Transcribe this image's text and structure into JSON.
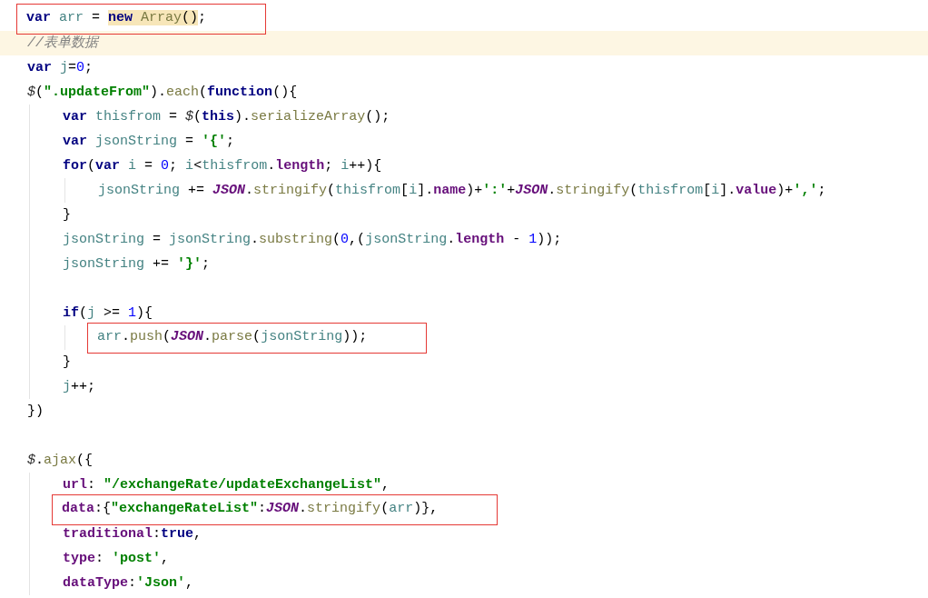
{
  "editor": {
    "lines": [
      {
        "kind": "code",
        "boxed": true,
        "current": false,
        "tokens": [
          {
            "kind": "kw",
            "text": "var "
          },
          {
            "kind": "var",
            "text": "arr"
          },
          {
            "kind": "punct",
            "text": " = "
          },
          {
            "kind": "kw",
            "text": "new ",
            "highlighted": true
          },
          {
            "kind": "fn",
            "text": "Array",
            "highlighted": true
          },
          {
            "kind": "punct",
            "text": "()",
            "highlighted": true
          },
          {
            "kind": "punct",
            "text": ";"
          }
        ]
      },
      {
        "kind": "code",
        "boxed": false,
        "current": true,
        "tokens": [
          {
            "kind": "comment",
            "text": "//表单数据"
          }
        ]
      },
      {
        "kind": "code",
        "boxed": false,
        "current": false,
        "tokens": [
          {
            "kind": "kw",
            "text": "var "
          },
          {
            "kind": "var",
            "text": "j"
          },
          {
            "kind": "punct",
            "text": "="
          },
          {
            "kind": "num",
            "text": "0"
          },
          {
            "kind": "punct",
            "text": ";"
          }
        ]
      },
      {
        "kind": "code",
        "boxed": false,
        "current": false,
        "tokens": [
          {
            "kind": "global",
            "text": "$"
          },
          {
            "kind": "punct",
            "text": "("
          },
          {
            "kind": "str",
            "text": "\".updateFrom\""
          },
          {
            "kind": "punct",
            "text": ")."
          },
          {
            "kind": "fn",
            "text": "each"
          },
          {
            "kind": "punct",
            "text": "("
          },
          {
            "kind": "kw",
            "text": "function"
          },
          {
            "kind": "punct",
            "text": "(){"
          }
        ],
        "children": [
          {
            "kind": "code",
            "boxed": false,
            "current": false,
            "tokens": [
              {
                "kind": "kw",
                "text": "var "
              },
              {
                "kind": "var",
                "text": "thisfrom"
              },
              {
                "kind": "punct",
                "text": " = "
              },
              {
                "kind": "global",
                "text": "$"
              },
              {
                "kind": "punct",
                "text": "("
              },
              {
                "kind": "kw",
                "text": "this"
              },
              {
                "kind": "punct",
                "text": ")."
              },
              {
                "kind": "fn",
                "text": "serializeArray"
              },
              {
                "kind": "punct",
                "text": "();"
              }
            ]
          },
          {
            "kind": "code",
            "boxed": false,
            "current": false,
            "tokens": [
              {
                "kind": "kw",
                "text": "var "
              },
              {
                "kind": "var",
                "text": "jsonString"
              },
              {
                "kind": "punct",
                "text": " = "
              },
              {
                "kind": "str",
                "text": "'{'"
              },
              {
                "kind": "punct",
                "text": ";"
              }
            ]
          },
          {
            "kind": "code",
            "boxed": false,
            "current": false,
            "tokens": [
              {
                "kind": "kw",
                "text": "for"
              },
              {
                "kind": "punct",
                "text": "("
              },
              {
                "kind": "kw",
                "text": "var "
              },
              {
                "kind": "var",
                "text": "i"
              },
              {
                "kind": "punct",
                "text": " = "
              },
              {
                "kind": "num",
                "text": "0"
              },
              {
                "kind": "punct",
                "text": "; "
              },
              {
                "kind": "var",
                "text": "i"
              },
              {
                "kind": "punct",
                "text": "<"
              },
              {
                "kind": "var",
                "text": "thisfrom"
              },
              {
                "kind": "punct",
                "text": "."
              },
              {
                "kind": "prop",
                "text": "length"
              },
              {
                "kind": "punct",
                "text": "; "
              },
              {
                "kind": "var",
                "text": "i"
              },
              {
                "kind": "punct",
                "text": "++){"
              }
            ],
            "children": [
              {
                "kind": "code",
                "boxed": false,
                "current": false,
                "tokens": [
                  {
                    "kind": "var",
                    "text": "jsonString"
                  },
                  {
                    "kind": "punct",
                    "text": " += "
                  },
                  {
                    "kind": "json",
                    "text": "JSON"
                  },
                  {
                    "kind": "punct",
                    "text": "."
                  },
                  {
                    "kind": "fn",
                    "text": "stringify"
                  },
                  {
                    "kind": "punct",
                    "text": "("
                  },
                  {
                    "kind": "var",
                    "text": "thisfrom"
                  },
                  {
                    "kind": "punct",
                    "text": "["
                  },
                  {
                    "kind": "var",
                    "text": "i"
                  },
                  {
                    "kind": "punct",
                    "text": "]."
                  },
                  {
                    "kind": "prop",
                    "text": "name"
                  },
                  {
                    "kind": "punct",
                    "text": ")+"
                  },
                  {
                    "kind": "str",
                    "text": "':'"
                  },
                  {
                    "kind": "punct",
                    "text": "+"
                  },
                  {
                    "kind": "json",
                    "text": "JSON"
                  },
                  {
                    "kind": "punct",
                    "text": "."
                  },
                  {
                    "kind": "fn",
                    "text": "stringify"
                  },
                  {
                    "kind": "punct",
                    "text": "("
                  },
                  {
                    "kind": "var",
                    "text": "thisfrom"
                  },
                  {
                    "kind": "punct",
                    "text": "["
                  },
                  {
                    "kind": "var",
                    "text": "i"
                  },
                  {
                    "kind": "punct",
                    "text": "]."
                  },
                  {
                    "kind": "prop",
                    "text": "value"
                  },
                  {
                    "kind": "punct",
                    "text": ")+"
                  },
                  {
                    "kind": "str",
                    "text": "','"
                  },
                  {
                    "kind": "punct",
                    "text": ";"
                  }
                ]
              }
            ]
          },
          {
            "kind": "code",
            "boxed": false,
            "current": false,
            "tokens": [
              {
                "kind": "punct",
                "text": "}"
              }
            ]
          },
          {
            "kind": "code",
            "boxed": false,
            "current": false,
            "tokens": [
              {
                "kind": "var",
                "text": "jsonString"
              },
              {
                "kind": "punct",
                "text": " = "
              },
              {
                "kind": "var",
                "text": "jsonString"
              },
              {
                "kind": "punct",
                "text": "."
              },
              {
                "kind": "fn",
                "text": "substring"
              },
              {
                "kind": "punct",
                "text": "("
              },
              {
                "kind": "num",
                "text": "0"
              },
              {
                "kind": "punct",
                "text": ",("
              },
              {
                "kind": "var",
                "text": "jsonString"
              },
              {
                "kind": "punct",
                "text": "."
              },
              {
                "kind": "prop",
                "text": "length"
              },
              {
                "kind": "punct",
                "text": " - "
              },
              {
                "kind": "num",
                "text": "1"
              },
              {
                "kind": "punct",
                "text": "));"
              }
            ]
          },
          {
            "kind": "code",
            "boxed": false,
            "current": false,
            "tokens": [
              {
                "kind": "var",
                "text": "jsonString"
              },
              {
                "kind": "punct",
                "text": " += "
              },
              {
                "kind": "str",
                "text": "'}'"
              },
              {
                "kind": "punct",
                "text": ";"
              }
            ]
          },
          {
            "kind": "blank"
          },
          {
            "kind": "code",
            "boxed": false,
            "current": false,
            "tokens": [
              {
                "kind": "kw",
                "text": "if"
              },
              {
                "kind": "punct",
                "text": "("
              },
              {
                "kind": "var",
                "text": "j"
              },
              {
                "kind": "punct",
                "text": " >= "
              },
              {
                "kind": "num",
                "text": "1"
              },
              {
                "kind": "punct",
                "text": "){"
              }
            ],
            "children": [
              {
                "kind": "code",
                "boxed": true,
                "current": false,
                "tokens": [
                  {
                    "kind": "var",
                    "text": "arr"
                  },
                  {
                    "kind": "punct",
                    "text": "."
                  },
                  {
                    "kind": "fn",
                    "text": "push"
                  },
                  {
                    "kind": "punct",
                    "text": "("
                  },
                  {
                    "kind": "json",
                    "text": "JSON"
                  },
                  {
                    "kind": "punct",
                    "text": "."
                  },
                  {
                    "kind": "fn",
                    "text": "parse"
                  },
                  {
                    "kind": "punct",
                    "text": "("
                  },
                  {
                    "kind": "var",
                    "text": "jsonString"
                  },
                  {
                    "kind": "punct",
                    "text": "));"
                  }
                ]
              }
            ]
          },
          {
            "kind": "code",
            "boxed": false,
            "current": false,
            "tokens": [
              {
                "kind": "punct",
                "text": "}"
              }
            ]
          },
          {
            "kind": "code",
            "boxed": false,
            "current": false,
            "tokens": [
              {
                "kind": "var",
                "text": "j"
              },
              {
                "kind": "punct",
                "text": "++;"
              }
            ]
          }
        ]
      },
      {
        "kind": "code",
        "boxed": false,
        "current": false,
        "tokens": [
          {
            "kind": "punct",
            "text": "})"
          }
        ]
      },
      {
        "kind": "blank"
      },
      {
        "kind": "code",
        "boxed": false,
        "current": false,
        "tokens": [
          {
            "kind": "global",
            "text": "$"
          },
          {
            "kind": "punct",
            "text": "."
          },
          {
            "kind": "fn",
            "text": "ajax"
          },
          {
            "kind": "punct",
            "text": "({"
          }
        ],
        "children": [
          {
            "kind": "code",
            "boxed": false,
            "current": false,
            "tokens": [
              {
                "kind": "prop",
                "text": "url"
              },
              {
                "kind": "punct",
                "text": ": "
              },
              {
                "kind": "str",
                "text": "\"/exchangeRate/updateExchangeList\""
              },
              {
                "kind": "punct",
                "text": ","
              }
            ]
          },
          {
            "kind": "code",
            "boxed": true,
            "current": false,
            "tokens": [
              {
                "kind": "prop",
                "text": "data"
              },
              {
                "kind": "punct",
                "text": ":{"
              },
              {
                "kind": "str",
                "text": "\"exchangeRateList\""
              },
              {
                "kind": "punct",
                "text": ":"
              },
              {
                "kind": "json",
                "text": "JSON"
              },
              {
                "kind": "punct",
                "text": "."
              },
              {
                "kind": "fn",
                "text": "stringify"
              },
              {
                "kind": "punct",
                "text": "("
              },
              {
                "kind": "var",
                "text": "arr"
              },
              {
                "kind": "punct",
                "text": ")},"
              }
            ]
          },
          {
            "kind": "code",
            "boxed": false,
            "current": false,
            "tokens": [
              {
                "kind": "prop",
                "text": "traditional"
              },
              {
                "kind": "punct",
                "text": ":"
              },
              {
                "kind": "kw",
                "text": "true"
              },
              {
                "kind": "punct",
                "text": ","
              }
            ]
          },
          {
            "kind": "code",
            "boxed": false,
            "current": false,
            "tokens": [
              {
                "kind": "prop",
                "text": "type"
              },
              {
                "kind": "punct",
                "text": ": "
              },
              {
                "kind": "str",
                "text": "'post'"
              },
              {
                "kind": "punct",
                "text": ","
              }
            ]
          },
          {
            "kind": "code",
            "boxed": false,
            "current": false,
            "tokens": [
              {
                "kind": "prop",
                "text": "dataType"
              },
              {
                "kind": "punct",
                "text": ":"
              },
              {
                "kind": "str",
                "text": "'Json'"
              },
              {
                "kind": "punct",
                "text": ","
              }
            ]
          }
        ]
      }
    ]
  }
}
